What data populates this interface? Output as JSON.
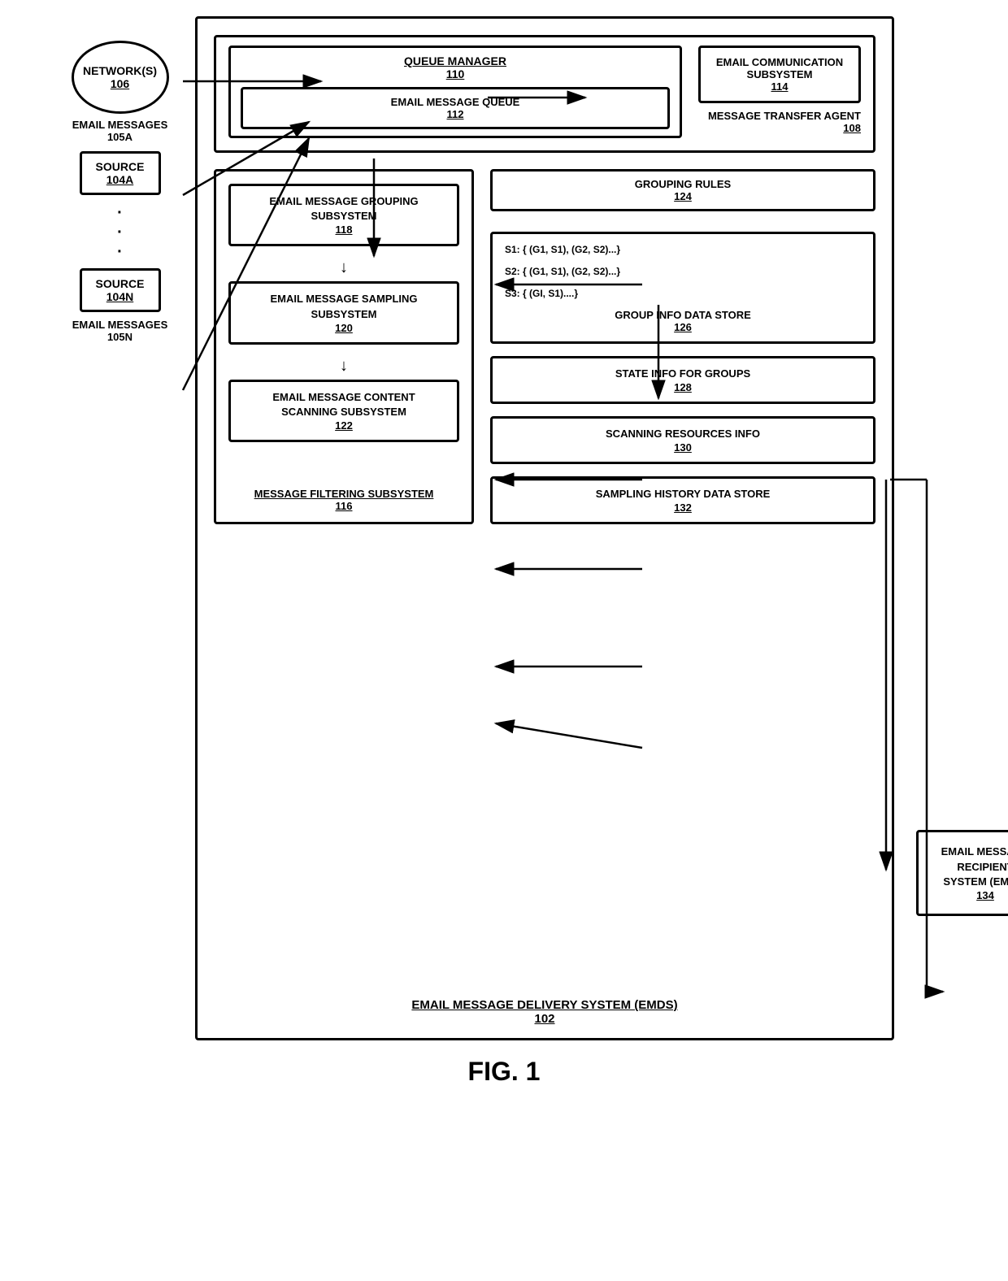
{
  "title": "FIG. 1",
  "emds": {
    "label": "EMAIL MESSAGE DELIVERY SYSTEM (EMDS)",
    "ref": "102"
  },
  "mta": {
    "label": "MESSAGE TRANSFER AGENT",
    "ref": "108"
  },
  "queueManager": {
    "title": "QUEUE MANAGER",
    "ref": "110",
    "emailQueue": {
      "title": "EMAIL MESSAGE QUEUE",
      "ref": "112"
    }
  },
  "ecs": {
    "title": "EMAIL COMMUNICATION SUBSYSTEM",
    "ref": "114"
  },
  "mfs": {
    "label": "MESSAGE FILTERING SUBSYSTEM",
    "ref": "116"
  },
  "emailMessageGrouping": {
    "title": "EMAIL MESSAGE GROUPING SUBSYSTEM",
    "ref": "118"
  },
  "emailMessageSampling": {
    "title": "EMAIL MESSAGE SAMPLING SUBSYSTEM",
    "ref": "120"
  },
  "emailMessageContent": {
    "title": "EMAIL MESSAGE CONTENT SCANNING SUBSYSTEM",
    "ref": "122"
  },
  "groupingRules": {
    "title": "GROUPING RULES",
    "ref": "124"
  },
  "groupInfoDataStore": {
    "s1": "S1: { (G1, S1), (G2, S2)...}",
    "s2": "S2: { (G1, S1), (G2, S2)...}",
    "s3": "S3: { (GI, S1)....}",
    "title": "GROUP INFO DATA STORE",
    "ref": "126"
  },
  "stateInfo": {
    "title": "STATE INFO FOR GROUPS",
    "ref": "128"
  },
  "scanningResources": {
    "title": "SCANNING RESOURCES INFO",
    "ref": "130"
  },
  "samplingHistory": {
    "title": "SAMPLING HISTORY DATA STORE",
    "ref": "132"
  },
  "emrs": {
    "title": "EMAIL MESSAGE RECIPIENT SYSTEM (EMRS)",
    "ref": "134"
  },
  "network": {
    "title": "NETWORK(S)",
    "ref": "106"
  },
  "sourceA": {
    "title": "SOURCE",
    "ref": "104A"
  },
  "sourceN": {
    "title": "SOURCE",
    "ref": "104N"
  },
  "emailMessagesA": {
    "label": "EMAIL MESSAGES",
    "ref": "105A"
  },
  "emailMessagesN": {
    "label": "EMAIL MESSAGES",
    "ref": "105N"
  }
}
